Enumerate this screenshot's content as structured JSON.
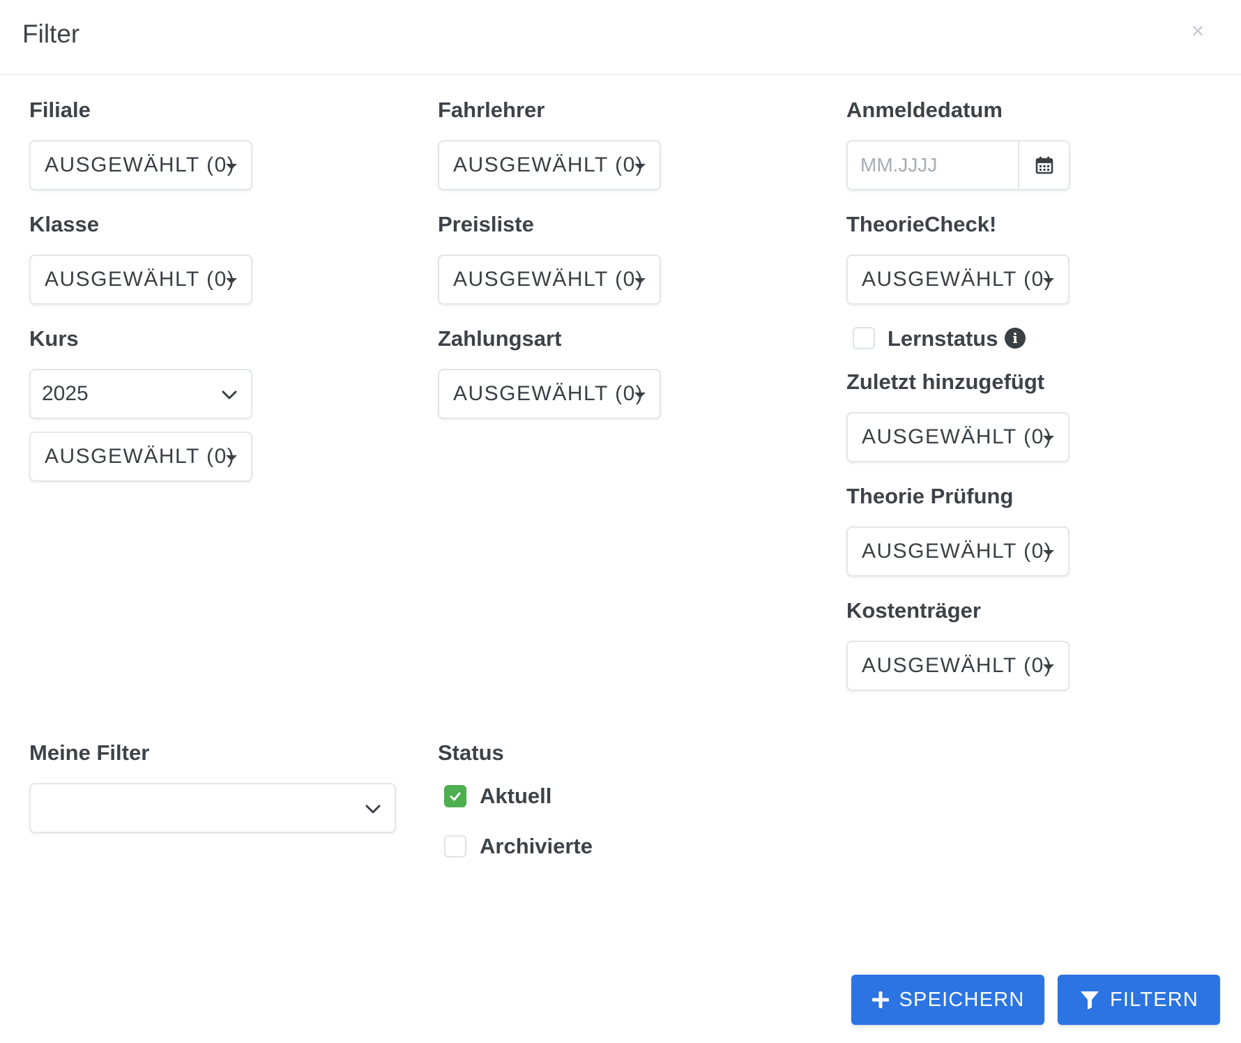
{
  "dialog": {
    "title": "Filter",
    "close_glyph": "×"
  },
  "fields": {
    "filiale": {
      "label": "Filiale",
      "value": "AUSGEWÄHLT (0)"
    },
    "klasse": {
      "label": "Klasse",
      "value": "AUSGEWÄHLT (0)"
    },
    "kurs": {
      "label": "Kurs",
      "year": "2025",
      "value": "AUSGEWÄHLT (0)"
    },
    "fahrlehrer": {
      "label": "Fahrlehrer",
      "value": "AUSGEWÄHLT (0)"
    },
    "preisliste": {
      "label": "Preisliste",
      "value": "AUSGEWÄHLT (0)"
    },
    "zahlungsart": {
      "label": "Zahlungsart",
      "value": "AUSGEWÄHLT (0)"
    },
    "anmeldedatum": {
      "label": "Anmeldedatum",
      "placeholder": "MM.JJJJ"
    },
    "theoriecheck": {
      "label": "TheorieCheck!",
      "value": "AUSGEWÄHLT (0)"
    },
    "lernstatus": {
      "label": "Lernstatus",
      "checked": false
    },
    "zuletzt": {
      "label": "Zuletzt hinzugefügt",
      "value": "AUSGEWÄHLT (0)"
    },
    "theorie_pruefung": {
      "label": "Theorie Prüfung",
      "value": "AUSGEWÄHLT (0)"
    },
    "kostentraeger": {
      "label": "Kostenträger",
      "value": "AUSGEWÄHLT (0)"
    },
    "meine_filter": {
      "label": "Meine Filter",
      "value": ""
    }
  },
  "status": {
    "label": "Status",
    "options": [
      {
        "label": "Aktuell",
        "checked": true
      },
      {
        "label": "Archivierte",
        "checked": false
      }
    ]
  },
  "actions": {
    "save_label": "SPEICHERN",
    "filter_label": "FILTERN"
  },
  "colors": {
    "primary": "#2b74e2",
    "checked": "#4caf50",
    "border": "#e3e5e8",
    "text": "#3a3f44"
  },
  "icons": {
    "close": "close-icon",
    "caret": "caret-down-icon",
    "chevron": "chevron-down-icon",
    "calendar": "calendar-icon",
    "info": "info-icon",
    "check": "check-icon",
    "plus": "plus-icon",
    "filter": "filter-icon"
  }
}
